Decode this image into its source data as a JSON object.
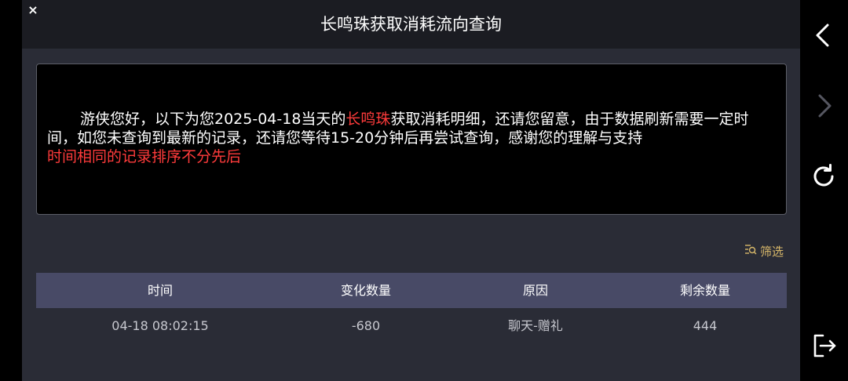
{
  "header": {
    "title": "长鸣珠获取消耗流向查询",
    "close_glyph": "×"
  },
  "notice": {
    "part1": "游侠您好，以下为您2025-04-18当天的",
    "highlight": "长鸣珠",
    "part2": "获取消耗明细，还请您留意，由于数据刷新需要一定时间，如您未查询到最新的记录，还请您等待15-20分钟后再尝试查询，感谢您的理解与支持",
    "red_line": "时间相同的记录排序不分先后"
  },
  "filter": {
    "label": "筛选",
    "icon": "filter-search-icon"
  },
  "table": {
    "columns": [
      "时间",
      "变化数量",
      "原因",
      "剩余数量"
    ],
    "rows": [
      [
        "04-18 08:02:15",
        "-680",
        "聊天-赠礼",
        "444"
      ]
    ]
  },
  "side_nav": {
    "icons": [
      "back-arrow-icon",
      "forward-arrow-icon",
      "refresh-icon",
      "exit-icon"
    ]
  },
  "colors": {
    "accent_red": "#ff3b3b",
    "filter_gold": "#d9b96a",
    "table_header": "#484a66",
    "panel_bg": "#2a2c36",
    "header_bg": "#1b1c22"
  }
}
